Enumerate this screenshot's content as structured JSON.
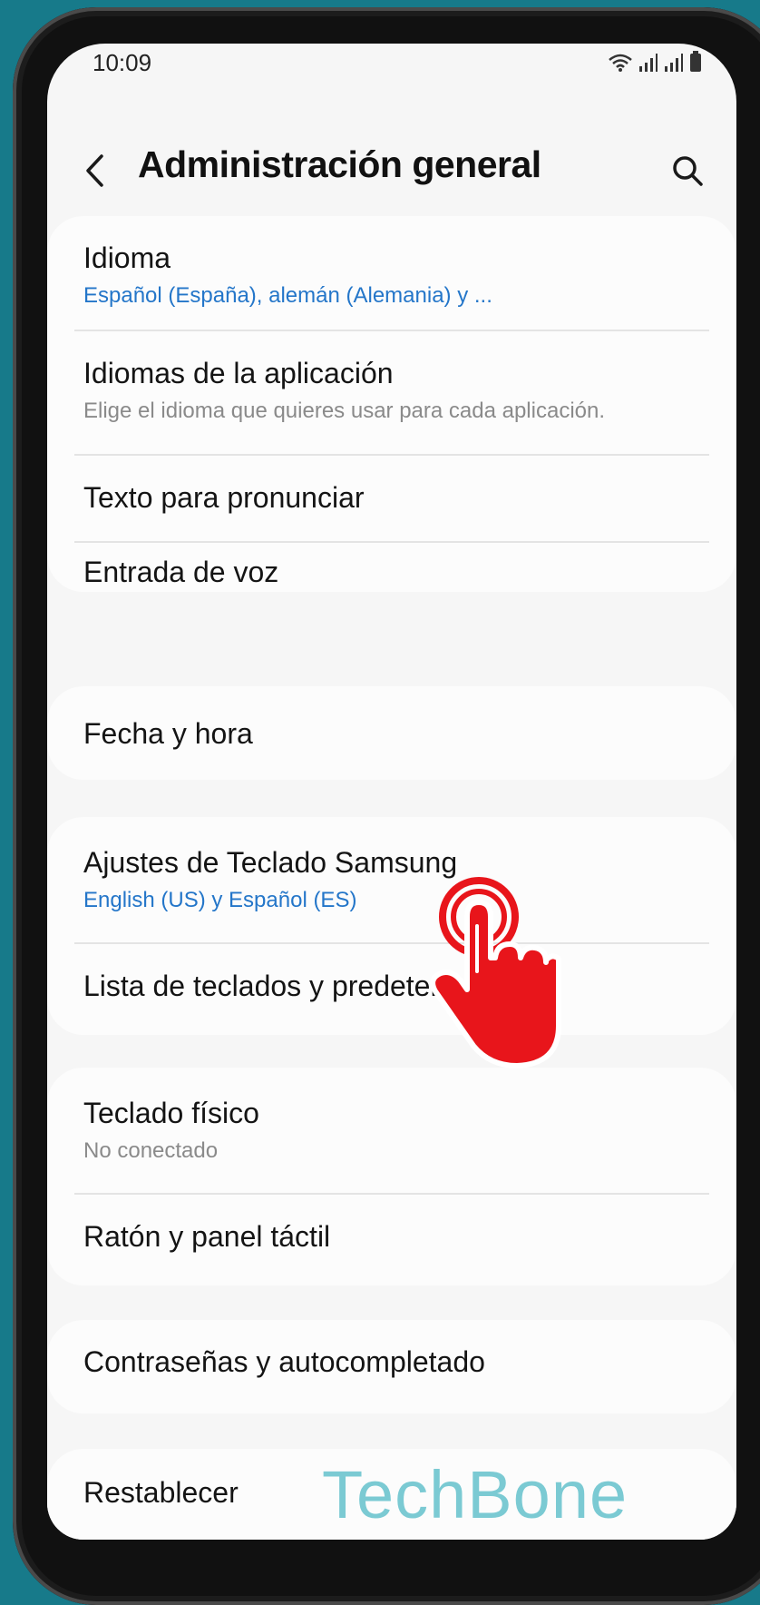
{
  "status_bar": {
    "time": "10:09"
  },
  "header": {
    "title": "Administración general",
    "back_icon": "chevron-left-icon",
    "search_icon": "search-icon"
  },
  "groups": [
    {
      "items": [
        {
          "title": "Idioma",
          "subtitle": "Español (España), alemán (Alemania) y ..."
        },
        {
          "title": "Idiomas de la aplicación",
          "subtitle": "Elige el idioma que quieres usar para cada aplicación."
        },
        {
          "title": "Texto para pronunciar"
        },
        {
          "title": "Entrada de voz"
        }
      ]
    },
    {
      "items": [
        {
          "title": "Fecha y hora"
        }
      ]
    },
    {
      "items": [
        {
          "title": "Ajustes de Teclado Samsung",
          "subtitle": "English (US) y Español (ES)"
        },
        {
          "title": "Lista de teclados y predeterminado"
        }
      ]
    },
    {
      "items": [
        {
          "title": "Teclado físico",
          "subtitle": "No conectado"
        },
        {
          "title": "Ratón y panel táctil"
        }
      ]
    },
    {
      "items": [
        {
          "title": "Contraseñas y autocompletado"
        }
      ]
    },
    {
      "items": [
        {
          "title": "Restablecer"
        }
      ]
    }
  ],
  "watermark": "TechBone",
  "colors": {
    "background": "#177a8a",
    "subtitle_blue": "#2476c9",
    "tap_indicator": "#e8151b"
  }
}
